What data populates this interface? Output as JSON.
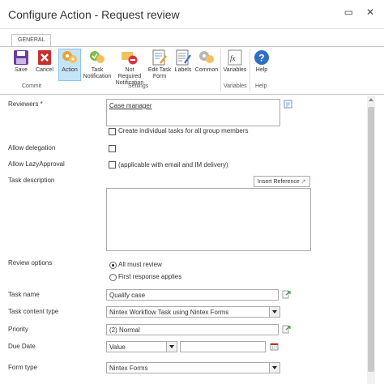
{
  "dialog": {
    "title": "Configure Action - Request review",
    "minimize_glyph": "▭",
    "close_glyph": "✕"
  },
  "ribbon": {
    "tab_general": "GENERAL",
    "buttons": {
      "save": "Save",
      "cancel": "Cancel",
      "action": "Action",
      "task_notification_1": "Task",
      "task_notification_2": "Notification",
      "not_required_1": "Not Required",
      "not_required_2": "Notification",
      "edit_task_form_1": "Edit Task",
      "edit_task_form_2": "Form",
      "labels": "Labels",
      "common": "Common",
      "variables": "Variables",
      "help": "Help"
    },
    "groups": {
      "commit": "Commit",
      "settings": "Settings",
      "variables": "Variables",
      "help": "Help"
    },
    "colors": {
      "selected_bg": "#c6e4f8",
      "selected_border": "#8fc3ea"
    }
  },
  "form": {
    "reviewers": {
      "label": "Reviewers *",
      "value": "Case manager"
    },
    "create_individual_tasks": {
      "label": "Create individual tasks for all group members",
      "checked": false
    },
    "allow_delegation": {
      "label": "Allow delegation",
      "checked": false
    },
    "allow_lazyapproval": {
      "label": "Allow LazyApproval",
      "text": "(applicable with email and IM delivery)",
      "checked": false
    },
    "task_description": {
      "label": "Task description",
      "insert_reference": "Insert Reference",
      "value": ""
    },
    "review_options": {
      "label": "Review options",
      "all_must_review": "All must review",
      "first_response": "First response applies",
      "selected": "All must review"
    },
    "task_name": {
      "label": "Task name",
      "value": "Qualify case"
    },
    "task_content_type": {
      "label": "Task content type",
      "value": "Nintex Workflow Task using Nintex Forms"
    },
    "priority": {
      "label": "Priority",
      "value": "(2) Normal"
    },
    "due_date": {
      "label": "Due Date",
      "type_value": "Value",
      "date_value": ""
    },
    "form_type": {
      "label": "Form type",
      "value": "Nintex Forms"
    }
  }
}
